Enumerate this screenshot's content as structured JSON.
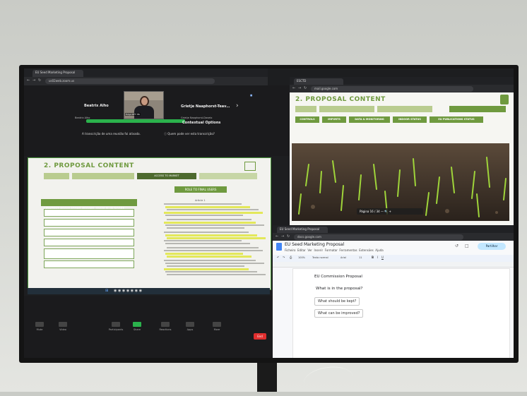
{
  "zoom": {
    "browser_tab": "EU Seed Marketing Proposal",
    "url": "us02web.zoom.us",
    "participants": [
      {
        "name": "Beatrix Alho",
        "label": "Beatrix Alho"
      },
      {
        "name": "Grietje Naaphorst-Teav…",
        "label": "Grietje Naaphorst-Davelo"
      }
    ],
    "main_speaker_tag": "Pulya RFT HS",
    "status_pill": "",
    "caption_left": "A transcrição de uma reunião foi ativada.",
    "caption_right": "Quem pode ver esta transcrição?",
    "contextual": "Contextual Options",
    "toolbar_items": [
      "Mute",
      "Video",
      "Participants",
      "Share",
      "Reactions",
      "Apps",
      "More",
      "End"
    ]
  },
  "slide": {
    "title": "2. PROPOSAL CONTENT",
    "top_buttons": [
      "",
      "",
      "ACCESS TO MARKET",
      ""
    ],
    "role_button": "ROLE TO FINAL USERS",
    "left_header": "LIGHTEST REGULATORY REGIME, EVEN IF IN SCOPE",
    "left_items": [
      "",
      "",
      "",
      "",
      "",
      ""
    ],
    "article_title": "Article 1"
  },
  "right_top": {
    "tab": "ESCTD",
    "url": "mail.google.com",
    "title": "2. PROPOSAL CONTENT",
    "small_buttons": [
      "",
      "",
      "",
      ""
    ],
    "nav_buttons": [
      "CONTROLS",
      "IMPORTS",
      "DATA & MONITORING",
      "INDOOR STATUS",
      "EU PUBLICATIONS STATUS"
    ],
    "page_label": "Página",
    "page_num": "16",
    "page_total": "34"
  },
  "right_docs": {
    "tab": "EU Seed Marketing Proposal",
    "url": "docs.google.com",
    "doc_title": "EU Seed Marketing Proposal",
    "menus": [
      "Ficheiro",
      "Editar",
      "Ver",
      "Inserir",
      "Formatar",
      "Ferramentas",
      "Extensões",
      "Ajuda"
    ],
    "toolbar_zoom": "100%",
    "style": "Texto normal",
    "font": "Arial",
    "font_size": "11",
    "share": "Partilhar",
    "lines": [
      "EU Commission Proposal",
      "What is in the proposal?",
      "What should be kept?",
      "What can be improved?"
    ]
  },
  "colors": {
    "green": "#6f9a3f",
    "dark_green": "#4d6a2e",
    "zoom_green": "#2bb24c",
    "end_red": "#e02e2e"
  }
}
